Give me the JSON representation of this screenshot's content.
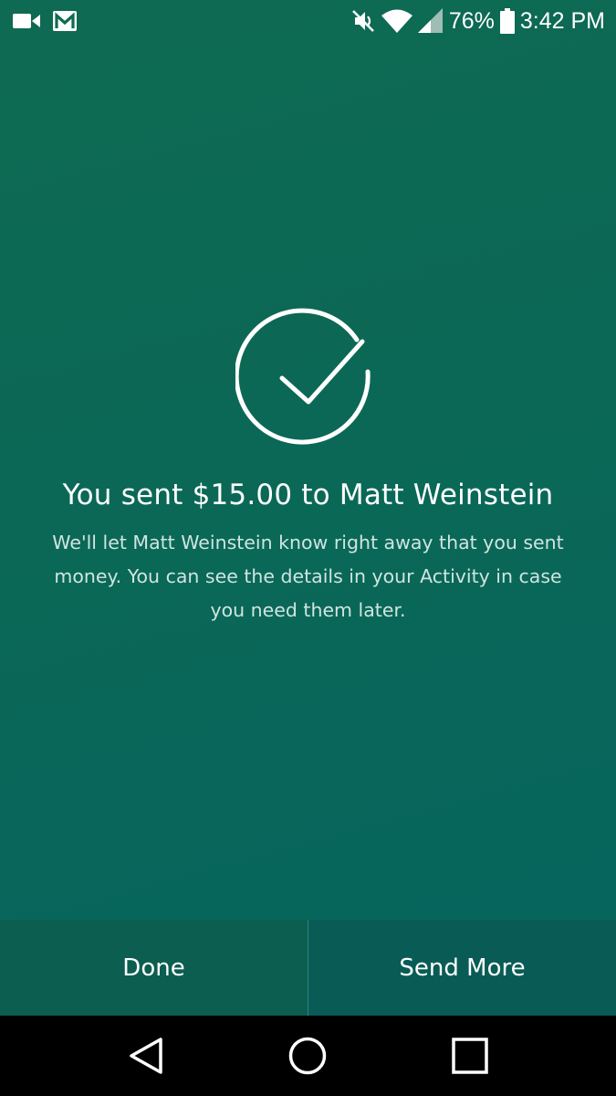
{
  "status_bar": {
    "left_icons": [
      "video-camera-icon",
      "gmail-icon"
    ],
    "right_icons": [
      "mute-icon",
      "wifi-icon",
      "cell-signal-icon",
      "battery-icon"
    ],
    "battery_percent": "76%",
    "time": "3:42 PM"
  },
  "success": {
    "icon": "checkmark-circle-icon",
    "title": "You sent $15.00 to Matt Weinstein",
    "message": "We'll let Matt Weinstein know right away that you sent money. You can see the details in your Activity in case you need them later."
  },
  "actions": {
    "done_label": "Done",
    "send_more_label": "Send More"
  },
  "navigation": {
    "buttons": [
      "back-icon",
      "home-icon",
      "recents-icon"
    ]
  },
  "colors": {
    "background": "#0b6856",
    "button_bar": "#0b5e50",
    "text": "#ffffff",
    "muted_text": "#cfe5df"
  }
}
